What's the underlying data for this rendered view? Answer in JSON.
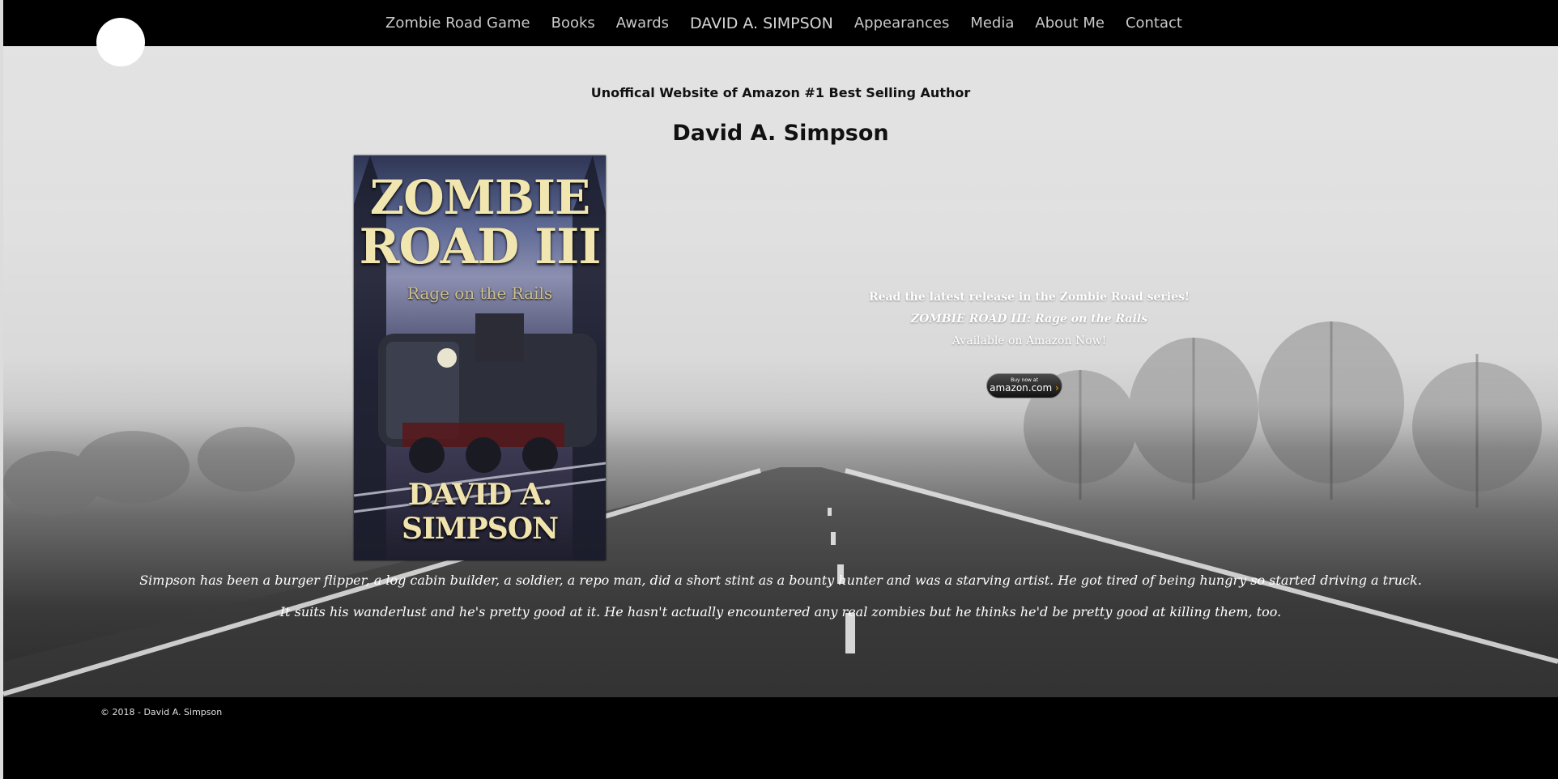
{
  "nav": {
    "items": [
      "Zombie Road Game",
      "Books",
      "Awards",
      "DAVID A. SIMPSON",
      "Appearances",
      "Media",
      "About Me",
      "Contact"
    ]
  },
  "hero": {
    "tagline": "Unoffical Website of Amazon #1 Best Selling Author",
    "author_name": "David A. Simpson",
    "cover": {
      "title_line1": "ZOMBIE",
      "title_line2": "ROAD III",
      "subtitle": "Rage on the Rails",
      "author": "DAVID A. SIMPSON"
    },
    "promo": {
      "line1": "Read the latest release in the Zombie Road series!",
      "line2": "ZOMBIE ROAD III: Rage on the Rails",
      "line3": "Available on Amazon Now!"
    },
    "amazon_button": {
      "small_text": "Buy now at",
      "big_text": "amazon.com",
      "arrow": "›"
    },
    "bio": [
      "Simpson has been a burger flipper, a log cabin builder, a soldier, a repo man, did a short stint as a bounty hunter and was a starving artist. He got tired of being hungry so started driving a truck.",
      "It suits his wanderlust and he's pretty good at it. He hasn't actually encountered any real zombies but he thinks he'd be pretty good at killing them, too."
    ]
  },
  "footer": {
    "copyright": "© 2018 - David A. Simpson"
  }
}
